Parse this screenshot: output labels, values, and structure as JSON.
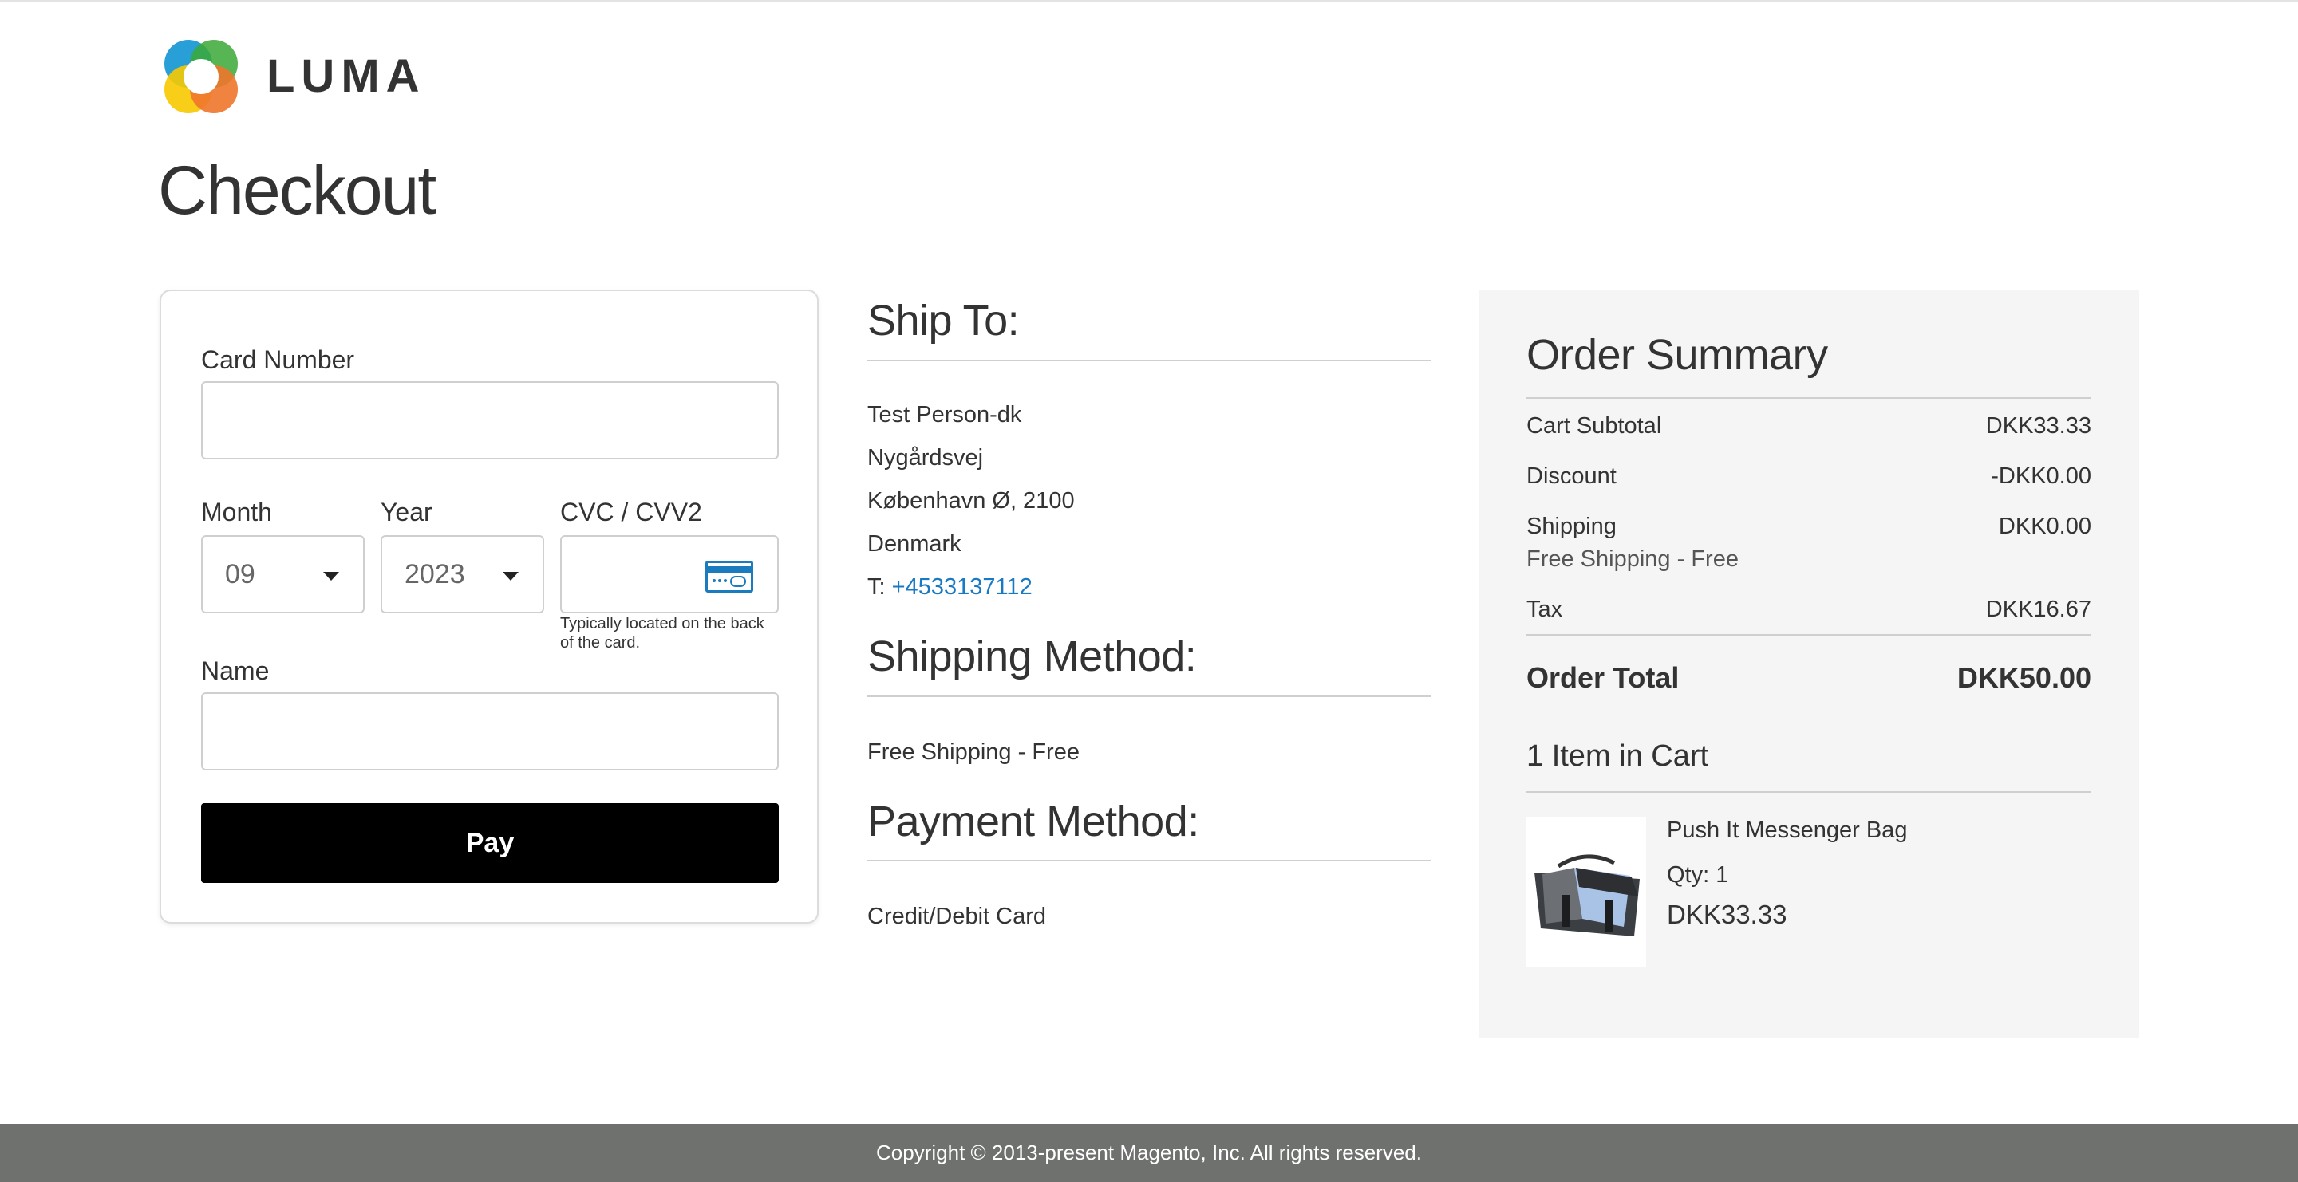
{
  "brand": {
    "name": "LUMA"
  },
  "page": {
    "title": "Checkout"
  },
  "payment_form": {
    "card_number_label": "Card Number",
    "card_number_value": "",
    "month_label": "Month",
    "month_value": "09",
    "year_label": "Year",
    "year_value": "2023",
    "cvc_label": "CVC / CVV2",
    "cvc_value": "",
    "cvc_hint_line1": "Typically located on the back",
    "cvc_hint_line2": "of the card.",
    "name_label": "Name",
    "name_value": "",
    "pay_button": "Pay"
  },
  "ship_to": {
    "title": "Ship To:",
    "name": "Test Person-dk",
    "street": "Nygårdsvej",
    "city": "København Ø, 2100",
    "country": "Denmark",
    "phone_prefix": "T:",
    "phone": "+4533137112"
  },
  "shipping_method": {
    "title": "Shipping Method:",
    "value": "Free Shipping - Free"
  },
  "payment_method": {
    "title": "Payment Method:",
    "value": "Credit/Debit Card"
  },
  "order_summary": {
    "title": "Order Summary",
    "cart_subtotal_label": "Cart Subtotal",
    "cart_subtotal_value": "DKK33.33",
    "discount_label": "Discount",
    "discount_value": "-DKK0.00",
    "shipping_label": "Shipping",
    "shipping_value": "DKK0.00",
    "shipping_sub": "Free Shipping - Free",
    "tax_label": "Tax",
    "tax_value": "DKK16.67",
    "order_total_label": "Order Total",
    "order_total_value": "DKK50.00",
    "items_in_cart": "1 Item in Cart",
    "items": [
      {
        "name": "Push It Messenger Bag",
        "qty": "Qty: 1",
        "price": "DKK33.33"
      }
    ]
  },
  "footer": {
    "copyright": "Copyright © 2013-present Magento, Inc. All rights reserved."
  },
  "colors": {
    "link": "#1979c3",
    "footer_bg": "#6e716e",
    "pay_button_bg": "#000000"
  }
}
